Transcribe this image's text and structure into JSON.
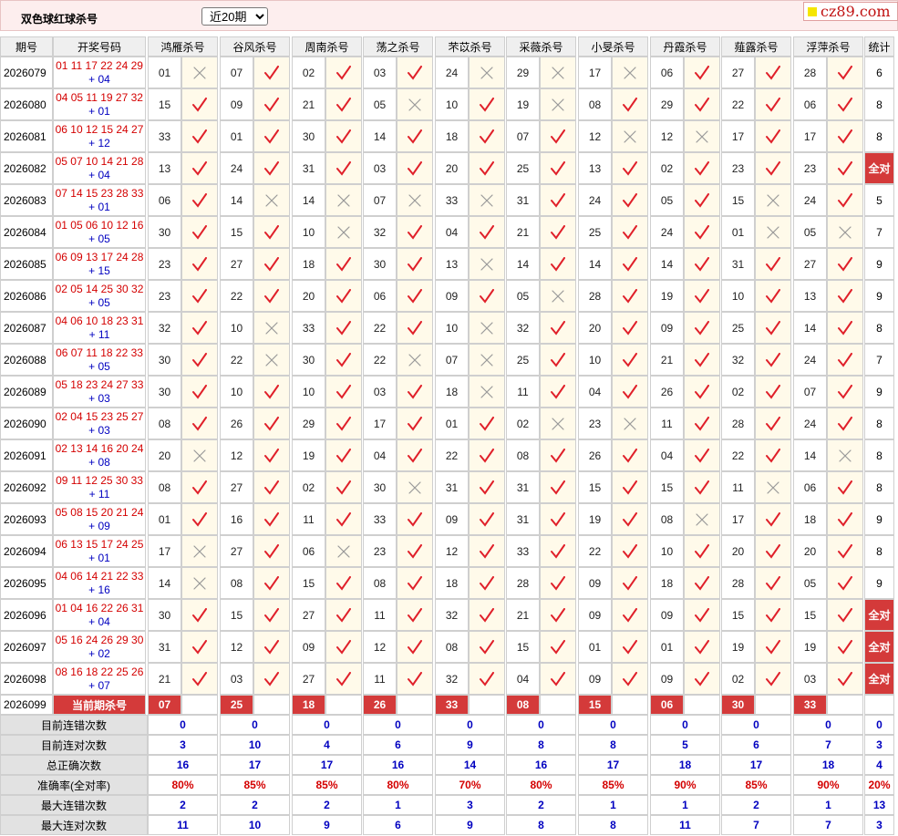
{
  "header": {
    "title": "双色球红球杀号",
    "period_select": "近20期",
    "logo": "cz89.com"
  },
  "columns": {
    "issue": "期号",
    "winning": "开奖号码",
    "experts": [
      "鸿雁杀号",
      "谷风杀号",
      "周南杀号",
      "荡之杀号",
      "芣苡杀号",
      "采薇杀号",
      "小旻杀号",
      "丹霞杀号",
      "薤露杀号",
      "浮萍杀号"
    ],
    "stat": "统计"
  },
  "rows": [
    {
      "issue": "2026079",
      "reds": "01 11 17 22 24 29",
      "blue": "+ 04",
      "kills": [
        [
          "01",
          0
        ],
        [
          "07",
          1
        ],
        [
          "02",
          1
        ],
        [
          "03",
          1
        ],
        [
          "24",
          0
        ],
        [
          "29",
          0
        ],
        [
          "17",
          0
        ],
        [
          "06",
          1
        ],
        [
          "27",
          1
        ],
        [
          "28",
          1
        ]
      ],
      "stat": "6"
    },
    {
      "issue": "2026080",
      "reds": "04 05 11 19 27 32",
      "blue": "+ 01",
      "kills": [
        [
          "15",
          1
        ],
        [
          "09",
          1
        ],
        [
          "21",
          1
        ],
        [
          "05",
          0
        ],
        [
          "10",
          1
        ],
        [
          "19",
          0
        ],
        [
          "08",
          1
        ],
        [
          "29",
          1
        ],
        [
          "22",
          1
        ],
        [
          "06",
          1
        ]
      ],
      "stat": "8"
    },
    {
      "issue": "2026081",
      "reds": "06 10 12 15 24 27",
      "blue": "+ 12",
      "kills": [
        [
          "33",
          1
        ],
        [
          "01",
          1
        ],
        [
          "30",
          1
        ],
        [
          "14",
          1
        ],
        [
          "18",
          1
        ],
        [
          "07",
          1
        ],
        [
          "12",
          0
        ],
        [
          "12",
          0
        ],
        [
          "17",
          1
        ],
        [
          "17",
          1
        ]
      ],
      "stat": "8"
    },
    {
      "issue": "2026082",
      "reds": "05 07 10 14 21 28",
      "blue": "+ 04",
      "kills": [
        [
          "13",
          1
        ],
        [
          "24",
          1
        ],
        [
          "31",
          1
        ],
        [
          "03",
          1
        ],
        [
          "20",
          1
        ],
        [
          "25",
          1
        ],
        [
          "13",
          1
        ],
        [
          "02",
          1
        ],
        [
          "23",
          1
        ],
        [
          "23",
          1
        ]
      ],
      "stat": "全对"
    },
    {
      "issue": "2026083",
      "reds": "07 14 15 23 28 33",
      "blue": "+ 01",
      "kills": [
        [
          "06",
          1
        ],
        [
          "14",
          0
        ],
        [
          "14",
          0
        ],
        [
          "07",
          0
        ],
        [
          "33",
          0
        ],
        [
          "31",
          1
        ],
        [
          "24",
          1
        ],
        [
          "05",
          1
        ],
        [
          "15",
          0
        ],
        [
          "24",
          1
        ]
      ],
      "stat": "5"
    },
    {
      "issue": "2026084",
      "reds": "01 05 06 10 12 16",
      "blue": "+ 05",
      "kills": [
        [
          "30",
          1
        ],
        [
          "15",
          1
        ],
        [
          "10",
          0
        ],
        [
          "32",
          1
        ],
        [
          "04",
          1
        ],
        [
          "21",
          1
        ],
        [
          "25",
          1
        ],
        [
          "24",
          1
        ],
        [
          "01",
          0
        ],
        [
          "05",
          0
        ]
      ],
      "stat": "7"
    },
    {
      "issue": "2026085",
      "reds": "06 09 13 17 24 28",
      "blue": "+ 15",
      "kills": [
        [
          "23",
          1
        ],
        [
          "27",
          1
        ],
        [
          "18",
          1
        ],
        [
          "30",
          1
        ],
        [
          "13",
          0
        ],
        [
          "14",
          1
        ],
        [
          "14",
          1
        ],
        [
          "14",
          1
        ],
        [
          "31",
          1
        ],
        [
          "27",
          1
        ]
      ],
      "stat": "9"
    },
    {
      "issue": "2026086",
      "reds": "02 05 14 25 30 32",
      "blue": "+ 05",
      "kills": [
        [
          "23",
          1
        ],
        [
          "22",
          1
        ],
        [
          "20",
          1
        ],
        [
          "06",
          1
        ],
        [
          "09",
          1
        ],
        [
          "05",
          0
        ],
        [
          "28",
          1
        ],
        [
          "19",
          1
        ],
        [
          "10",
          1
        ],
        [
          "13",
          1
        ]
      ],
      "stat": "9"
    },
    {
      "issue": "2026087",
      "reds": "04 06 10 18 23 31",
      "blue": "+ 11",
      "kills": [
        [
          "32",
          1
        ],
        [
          "10",
          0
        ],
        [
          "33",
          1
        ],
        [
          "22",
          1
        ],
        [
          "10",
          0
        ],
        [
          "32",
          1
        ],
        [
          "20",
          1
        ],
        [
          "09",
          1
        ],
        [
          "25",
          1
        ],
        [
          "14",
          1
        ]
      ],
      "stat": "8"
    },
    {
      "issue": "2026088",
      "reds": "06 07 11 18 22 33",
      "blue": "+ 05",
      "kills": [
        [
          "30",
          1
        ],
        [
          "22",
          0
        ],
        [
          "30",
          1
        ],
        [
          "22",
          0
        ],
        [
          "07",
          0
        ],
        [
          "25",
          1
        ],
        [
          "10",
          1
        ],
        [
          "21",
          1
        ],
        [
          "32",
          1
        ],
        [
          "24",
          1
        ]
      ],
      "stat": "7"
    },
    {
      "issue": "2026089",
      "reds": "05 18 23 24 27 33",
      "blue": "+ 03",
      "kills": [
        [
          "30",
          1
        ],
        [
          "10",
          1
        ],
        [
          "10",
          1
        ],
        [
          "03",
          1
        ],
        [
          "18",
          0
        ],
        [
          "11",
          1
        ],
        [
          "04",
          1
        ],
        [
          "26",
          1
        ],
        [
          "02",
          1
        ],
        [
          "07",
          1
        ]
      ],
      "stat": "9"
    },
    {
      "issue": "2026090",
      "reds": "02 04 15 23 25 27",
      "blue": "+ 03",
      "kills": [
        [
          "08",
          1
        ],
        [
          "26",
          1
        ],
        [
          "29",
          1
        ],
        [
          "17",
          1
        ],
        [
          "01",
          1
        ],
        [
          "02",
          0
        ],
        [
          "23",
          0
        ],
        [
          "11",
          1
        ],
        [
          "28",
          1
        ],
        [
          "24",
          1
        ]
      ],
      "stat": "8"
    },
    {
      "issue": "2026091",
      "reds": "02 13 14 16 20 24",
      "blue": "+ 08",
      "kills": [
        [
          "20",
          0
        ],
        [
          "12",
          1
        ],
        [
          "19",
          1
        ],
        [
          "04",
          1
        ],
        [
          "22",
          1
        ],
        [
          "08",
          1
        ],
        [
          "26",
          1
        ],
        [
          "04",
          1
        ],
        [
          "22",
          1
        ],
        [
          "14",
          0
        ]
      ],
      "stat": "8"
    },
    {
      "issue": "2026092",
      "reds": "09 11 12 25 30 33",
      "blue": "+ 11",
      "kills": [
        [
          "08",
          1
        ],
        [
          "27",
          1
        ],
        [
          "02",
          1
        ],
        [
          "30",
          0
        ],
        [
          "31",
          1
        ],
        [
          "31",
          1
        ],
        [
          "15",
          1
        ],
        [
          "15",
          1
        ],
        [
          "11",
          0
        ],
        [
          "06",
          1
        ]
      ],
      "stat": "8"
    },
    {
      "issue": "2026093",
      "reds": "05 08 15 20 21 24",
      "blue": "+ 09",
      "kills": [
        [
          "01",
          1
        ],
        [
          "16",
          1
        ],
        [
          "11",
          1
        ],
        [
          "33",
          1
        ],
        [
          "09",
          1
        ],
        [
          "31",
          1
        ],
        [
          "19",
          1
        ],
        [
          "08",
          0
        ],
        [
          "17",
          1
        ],
        [
          "18",
          1
        ]
      ],
      "stat": "9"
    },
    {
      "issue": "2026094",
      "reds": "06 13 15 17 24 25",
      "blue": "+ 01",
      "kills": [
        [
          "17",
          0
        ],
        [
          "27",
          1
        ],
        [
          "06",
          0
        ],
        [
          "23",
          1
        ],
        [
          "12",
          1
        ],
        [
          "33",
          1
        ],
        [
          "22",
          1
        ],
        [
          "10",
          1
        ],
        [
          "20",
          1
        ],
        [
          "20",
          1
        ]
      ],
      "stat": "8"
    },
    {
      "issue": "2026095",
      "reds": "04 06 14 21 22 33",
      "blue": "+ 16",
      "kills": [
        [
          "14",
          0
        ],
        [
          "08",
          1
        ],
        [
          "15",
          1
        ],
        [
          "08",
          1
        ],
        [
          "18",
          1
        ],
        [
          "28",
          1
        ],
        [
          "09",
          1
        ],
        [
          "18",
          1
        ],
        [
          "28",
          1
        ],
        [
          "05",
          1
        ]
      ],
      "stat": "9"
    },
    {
      "issue": "2026096",
      "reds": "01 04 16 22 26 31",
      "blue": "+ 04",
      "kills": [
        [
          "30",
          1
        ],
        [
          "15",
          1
        ],
        [
          "27",
          1
        ],
        [
          "11",
          1
        ],
        [
          "32",
          1
        ],
        [
          "21",
          1
        ],
        [
          "09",
          1
        ],
        [
          "09",
          1
        ],
        [
          "15",
          1
        ],
        [
          "15",
          1
        ]
      ],
      "stat": "全对"
    },
    {
      "issue": "2026097",
      "reds": "05 16 24 26 29 30",
      "blue": "+ 02",
      "kills": [
        [
          "31",
          1
        ],
        [
          "12",
          1
        ],
        [
          "09",
          1
        ],
        [
          "12",
          1
        ],
        [
          "08",
          1
        ],
        [
          "15",
          1
        ],
        [
          "01",
          1
        ],
        [
          "01",
          1
        ],
        [
          "19",
          1
        ],
        [
          "19",
          1
        ]
      ],
      "stat": "全对"
    },
    {
      "issue": "2026098",
      "reds": "08 16 18 22 25 26",
      "blue": "+ 07",
      "kills": [
        [
          "21",
          1
        ],
        [
          "03",
          1
        ],
        [
          "27",
          1
        ],
        [
          "11",
          1
        ],
        [
          "32",
          1
        ],
        [
          "04",
          1
        ],
        [
          "09",
          1
        ],
        [
          "09",
          1
        ],
        [
          "02",
          1
        ],
        [
          "03",
          1
        ]
      ],
      "stat": "全对"
    }
  ],
  "current": {
    "issue": "2026099",
    "label": "当前期杀号",
    "kills": [
      "07",
      "25",
      "18",
      "26",
      "33",
      "08",
      "15",
      "06",
      "30",
      "33"
    ]
  },
  "stats": [
    {
      "label": "目前连错次数",
      "values": [
        "0",
        "0",
        "0",
        "0",
        "0",
        "0",
        "0",
        "0",
        "0",
        "0"
      ],
      "stat": "0",
      "red": false
    },
    {
      "label": "目前连对次数",
      "values": [
        "3",
        "10",
        "4",
        "6",
        "9",
        "8",
        "8",
        "5",
        "6",
        "7"
      ],
      "stat": "3",
      "red": false
    },
    {
      "label": "总正确次数",
      "values": [
        "16",
        "17",
        "17",
        "16",
        "14",
        "16",
        "17",
        "18",
        "17",
        "18"
      ],
      "stat": "4",
      "red": false
    },
    {
      "label": "准确率(全对率)",
      "values": [
        "80%",
        "85%",
        "85%",
        "80%",
        "70%",
        "80%",
        "85%",
        "90%",
        "85%",
        "90%"
      ],
      "stat": "20%",
      "red": true
    },
    {
      "label": "最大连错次数",
      "values": [
        "2",
        "2",
        "2",
        "1",
        "3",
        "2",
        "1",
        "1",
        "2",
        "1"
      ],
      "stat": "13",
      "red": false
    },
    {
      "label": "最大连对次数",
      "values": [
        "11",
        "10",
        "9",
        "6",
        "9",
        "8",
        "8",
        "11",
        "7",
        "7"
      ],
      "stat": "3",
      "red": false
    }
  ]
}
